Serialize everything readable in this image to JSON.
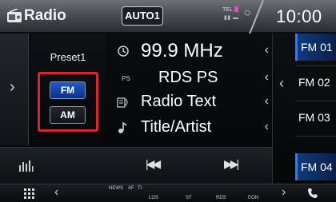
{
  "header": {
    "title": "Radio",
    "badge": "AUTO1",
    "tel_label": "TEL",
    "clock": "10:00"
  },
  "presets_panel": {
    "preset_label": "Preset1",
    "band_fm": "FM",
    "band_am": "AM"
  },
  "info": {
    "frequency": "99.9 MHz",
    "ps_tag": "PS",
    "ps_name": "RDS PS",
    "radio_text": "Radio Text",
    "title_artist": "Title/Artist"
  },
  "preset_list": [
    {
      "label": "FM 01"
    },
    {
      "label": "FM 02"
    },
    {
      "label": "FM 03"
    },
    {
      "label": "FM 04"
    }
  ],
  "bottom_bar": {
    "news": "NEWS",
    "af": "AF",
    "ti": "TI",
    "los": "LOS",
    "st": "ST",
    "rds": "RDS",
    "eon": "EON"
  },
  "colors": {
    "accent_blue": "#2c7cff",
    "highlight_red": "#d8262e"
  }
}
